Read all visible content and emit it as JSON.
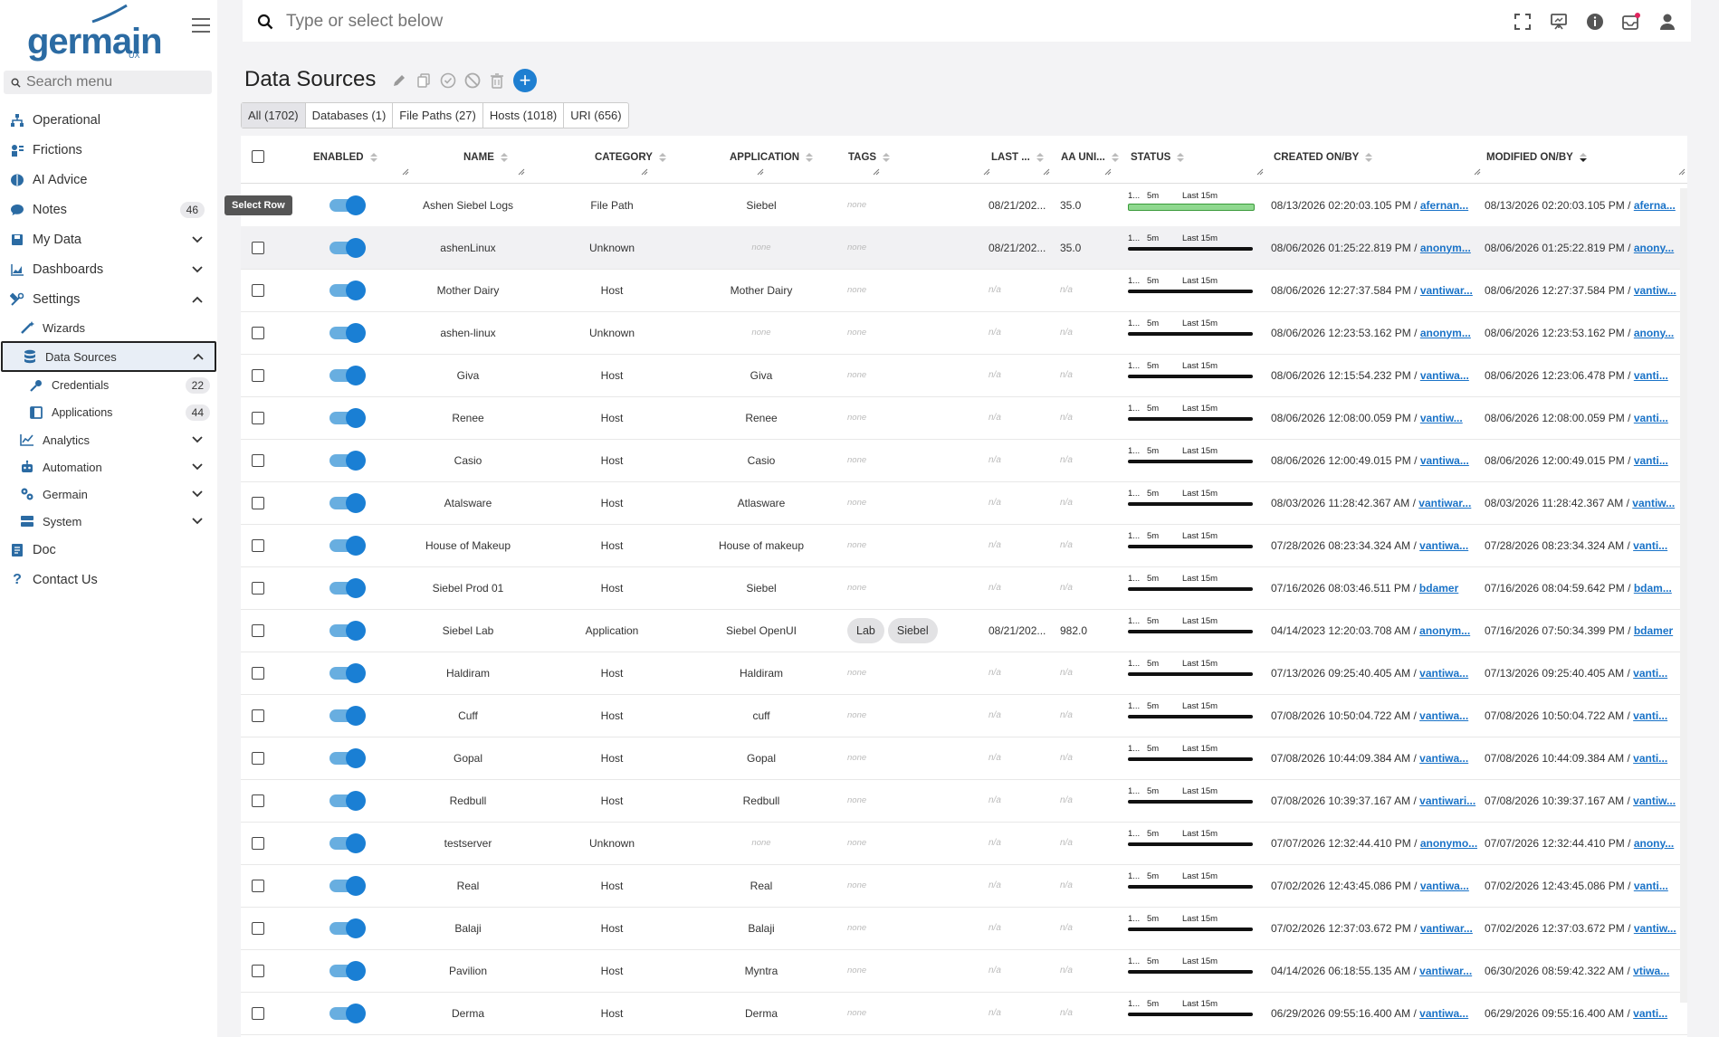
{
  "app": {
    "logo": "germain",
    "logo_sub": "UX",
    "brand_color": "#2b6ba3",
    "accent": "#1a7fd4"
  },
  "sidebar": {
    "search_placeholder": "Search menu",
    "items": [
      {
        "label": "Operational"
      },
      {
        "label": "Frictions"
      },
      {
        "label": "AI Advice"
      },
      {
        "label": "Notes",
        "badge": "46"
      },
      {
        "label": "My Data"
      },
      {
        "label": "Dashboards"
      },
      {
        "label": "Settings"
      },
      {
        "label": "Wizards"
      },
      {
        "label": "Data Sources"
      },
      {
        "label": "Credentials",
        "badge": "22"
      },
      {
        "label": "Applications",
        "badge": "44"
      },
      {
        "label": "Analytics"
      },
      {
        "label": "Automation"
      },
      {
        "label": "Germain"
      },
      {
        "label": "System"
      },
      {
        "label": "Doc"
      },
      {
        "label": "Contact Us"
      }
    ]
  },
  "topbar": {
    "search_placeholder": "Type or select below"
  },
  "page": {
    "title": "Data Sources"
  },
  "filter_tabs": [
    {
      "label": "All (1702)"
    },
    {
      "label": "Databases (1)"
    },
    {
      "label": "File Paths (27)"
    },
    {
      "label": "Hosts (1018)"
    },
    {
      "label": "URI (656)"
    }
  ],
  "columns": {
    "enabled": "ENABLED",
    "name": "NAME",
    "category": "CATEGORY",
    "application": "APPLICATION",
    "tags": "TAGS",
    "last": "LAST ...",
    "aa": "AA UNI...",
    "status": "STATUS",
    "created": "CREATED ON/BY",
    "modified": "MODIFIED ON/BY"
  },
  "tooltip": "Select Row",
  "status_labels": {
    "a": "1...",
    "b": "5m",
    "c": "Last 15m"
  },
  "rows": [
    {
      "name": "Ashen Siebel Logs",
      "category": "File Path",
      "application": "Siebel",
      "tags": "none",
      "last": "08/21/202...",
      "aa": "35.0",
      "status": "green",
      "created": "08/13/2026 02:20:03.105 PM /",
      "created_by": "afernan...",
      "modified": "08/13/2026 02:20:03.105 PM /",
      "modified_by": "aferna..."
    },
    {
      "name": "ashenLinux",
      "category": "Unknown",
      "application": "none",
      "tags": "none",
      "last": "08/21/202...",
      "aa": "35.0",
      "status": "black",
      "created": "08/06/2026 01:25:22.819 PM /",
      "created_by": "anonym...",
      "modified": "08/06/2026 01:25:22.819 PM /",
      "modified_by": "anony..."
    },
    {
      "name": "Mother Dairy",
      "category": "Host",
      "application": "Mother Dairy",
      "tags": "none",
      "last": "n/a",
      "aa": "n/a",
      "status": "black",
      "created": "08/06/2026 12:27:37.584 PM /",
      "created_by": "vantiwar...",
      "modified": "08/06/2026 12:27:37.584 PM /",
      "modified_by": "vantiw..."
    },
    {
      "name": "ashen-linux",
      "category": "Unknown",
      "application": "none",
      "tags": "none",
      "last": "n/a",
      "aa": "n/a",
      "status": "black",
      "created": "08/06/2026 12:23:53.162 PM /",
      "created_by": "anonym...",
      "modified": "08/06/2026 12:23:53.162 PM /",
      "modified_by": "anony..."
    },
    {
      "name": "Giva",
      "category": "Host",
      "application": "Giva",
      "tags": "none",
      "last": "n/a",
      "aa": "n/a",
      "status": "black",
      "created": "08/06/2026 12:15:54.232 PM /",
      "created_by": "vantiwa...",
      "modified": "08/06/2026 12:23:06.478 PM /",
      "modified_by": "vanti..."
    },
    {
      "name": "Renee",
      "category": "Host",
      "application": "Renee",
      "tags": "none",
      "last": "n/a",
      "aa": "n/a",
      "status": "black",
      "created": "08/06/2026 12:08:00.059 PM /",
      "created_by": "vantiw...",
      "modified": "08/06/2026 12:08:00.059 PM /",
      "modified_by": "vanti..."
    },
    {
      "name": "Casio",
      "category": "Host",
      "application": "Casio",
      "tags": "none",
      "last": "n/a",
      "aa": "n/a",
      "status": "black",
      "created": "08/06/2026 12:00:49.015 PM /",
      "created_by": "vantiwa...",
      "modified": "08/06/2026 12:00:49.015 PM /",
      "modified_by": "vanti..."
    },
    {
      "name": "Atalsware",
      "category": "Host",
      "application": "Atlasware",
      "tags": "none",
      "last": "n/a",
      "aa": "n/a",
      "status": "black",
      "created": "08/03/2026 11:28:42.367 AM /",
      "created_by": "vantiwar...",
      "modified": "08/03/2026 11:28:42.367 AM /",
      "modified_by": "vantiw..."
    },
    {
      "name": "House of Makeup",
      "category": "Host",
      "application": "House of makeup",
      "tags": "none",
      "last": "n/a",
      "aa": "n/a",
      "status": "black",
      "created": "07/28/2026 08:23:34.324 AM /",
      "created_by": "vantiwa...",
      "modified": "07/28/2026 08:23:34.324 AM /",
      "modified_by": "vanti..."
    },
    {
      "name": "Siebel Prod 01",
      "category": "Host",
      "application": "Siebel",
      "tags": "none",
      "last": "n/a",
      "aa": "n/a",
      "status": "black",
      "created": "07/16/2026 08:03:46.511 PM /",
      "created_by": "bdamer",
      "modified": "07/16/2026 08:04:59.642 PM /",
      "modified_by": "bdam..."
    },
    {
      "name": "Siebel Lab",
      "category": "Application",
      "application": "Siebel OpenUI",
      "tags": [
        "Lab",
        "Siebel"
      ],
      "last": "08/21/202...",
      "aa": "982.0",
      "status": "black",
      "created": "04/14/2023 12:20:03.708 AM /",
      "created_by": "anonym...",
      "modified": "07/16/2026 07:50:34.399 PM /",
      "modified_by": "bdamer"
    },
    {
      "name": "Haldiram",
      "category": "Host",
      "application": "Haldiram",
      "tags": "none",
      "last": "n/a",
      "aa": "n/a",
      "status": "black",
      "created": "07/13/2026 09:25:40.405 AM /",
      "created_by": "vantiwa...",
      "modified": "07/13/2026 09:25:40.405 AM /",
      "modified_by": "vanti..."
    },
    {
      "name": "Cuff",
      "category": "Host",
      "application": "cuff",
      "tags": "none",
      "last": "n/a",
      "aa": "n/a",
      "status": "black",
      "created": "07/08/2026 10:50:04.722 AM /",
      "created_by": "vantiwa...",
      "modified": "07/08/2026 10:50:04.722 AM /",
      "modified_by": "vanti..."
    },
    {
      "name": "Gopal",
      "category": "Host",
      "application": "Gopal",
      "tags": "none",
      "last": "n/a",
      "aa": "n/a",
      "status": "black",
      "created": "07/08/2026 10:44:09.384 AM /",
      "created_by": "vantiwa...",
      "modified": "07/08/2026 10:44:09.384 AM /",
      "modified_by": "vanti..."
    },
    {
      "name": "Redbull",
      "category": "Host",
      "application": "Redbull",
      "tags": "none",
      "last": "n/a",
      "aa": "n/a",
      "status": "black",
      "created": "07/08/2026 10:39:37.167 AM /",
      "created_by": "vantiwari...",
      "modified": "07/08/2026 10:39:37.167 AM /",
      "modified_by": "vantiw..."
    },
    {
      "name": "testserver",
      "category": "Unknown",
      "application": "none",
      "tags": "none",
      "last": "n/a",
      "aa": "n/a",
      "status": "black",
      "created": "07/07/2026 12:32:44.410 PM /",
      "created_by": "anonymo...",
      "modified": "07/07/2026 12:32:44.410 PM /",
      "modified_by": "anony..."
    },
    {
      "name": "Real",
      "category": "Host",
      "application": "Real",
      "tags": "none",
      "last": "n/a",
      "aa": "n/a",
      "status": "black",
      "created": "07/02/2026 12:43:45.086 PM /",
      "created_by": "vantiwa...",
      "modified": "07/02/2026 12:43:45.086 PM /",
      "modified_by": "vanti..."
    },
    {
      "name": "Balaji",
      "category": "Host",
      "application": "Balaji",
      "tags": "none",
      "last": "n/a",
      "aa": "n/a",
      "status": "black",
      "created": "07/02/2026 12:37:03.672 PM /",
      "created_by": "vantiwar...",
      "modified": "07/02/2026 12:37:03.672 PM /",
      "modified_by": "vantiw..."
    },
    {
      "name": "Pavilion",
      "category": "Host",
      "application": "Myntra",
      "tags": "none",
      "last": "n/a",
      "aa": "n/a",
      "status": "black",
      "created": "04/14/2026 06:18:55.135 AM /",
      "created_by": "vantiwar...",
      "modified": "06/30/2026 08:59:42.322 AM /",
      "modified_by": "vtiwa..."
    },
    {
      "name": "Derma",
      "category": "Host",
      "application": "Derma",
      "tags": "none",
      "last": "n/a",
      "aa": "n/a",
      "status": "black",
      "created": "06/29/2026 09:55:16.400 AM /",
      "created_by": "vantiwa...",
      "modified": "06/29/2026 09:55:16.400 AM /",
      "modified_by": "vanti..."
    }
  ]
}
